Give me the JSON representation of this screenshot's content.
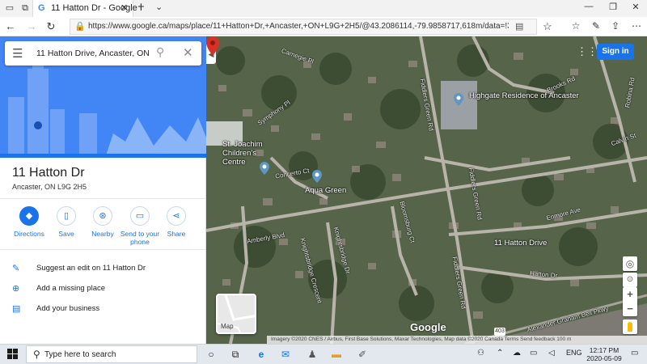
{
  "browser": {
    "tab_title": "11 Hatton Dr - Google I",
    "url": "https://www.google.ca/maps/place/11+Hatton+Dr,+Ancaster,+ON+L9G+2H5/@43.2086114,-79.9858717,618m/data=!3m1!1e3!4m5!3m4!1s0x882c85"
  },
  "search": {
    "query": "11 Hatton Drive, Ancaster, ON"
  },
  "place": {
    "name": "11 Hatton Dr",
    "address": "Ancaster, ON L9G 2H5"
  },
  "actions": [
    {
      "label": "Directions",
      "icon": "directions-icon"
    },
    {
      "label": "Save",
      "icon": "bookmark-icon"
    },
    {
      "label": "Nearby",
      "icon": "nearby-icon"
    },
    {
      "label": "Send to your phone",
      "icon": "phone-icon"
    },
    {
      "label": "Share",
      "icon": "share-icon"
    }
  ],
  "menu": [
    {
      "label": "Suggest an edit on 11 Hatton Dr",
      "icon": "pencil-icon"
    },
    {
      "label": "Add a missing place",
      "icon": "add-place-icon"
    },
    {
      "label": "Add your business",
      "icon": "business-icon"
    }
  ],
  "map": {
    "sign_in": "Sign in",
    "minimap_label": "Map",
    "logo": "Google",
    "pin_label": "11 Hatton Drive",
    "highway_shield": "403",
    "attribution": "Imagery ©2020 CNES / Airbus, First Base Solutions, Maxar Technologies, Map data ©2020    Canada    Terms    Send feedback    100 m",
    "places": [
      {
        "name": "Highgate Residence of Ancaster"
      },
      {
        "name": "St. Joachim Children's Centre"
      },
      {
        "name": "Aqua Green"
      }
    ],
    "roads": [
      "Carnegie Pl",
      "Symphony Pl",
      "Concerto Ct",
      "Fiddlers Green Rd",
      "Brooks Rd",
      "Robina Rd",
      "Calvin St",
      "Enmore Ave",
      "Amberly Blvd",
      "Bloomsburg Ct",
      "Knightsbridge Dr",
      "Knightsbridge Crescent",
      "Hatton Dr",
      "Alexander Graham Bell Pkwy",
      "Concerto Ct",
      "Knightsbridge Ct",
      "Carrington Crescent",
      "Macgregor Dr",
      "Calvin St",
      "Hatton Dr"
    ]
  },
  "taskbar": {
    "search_placeholder": "Type here to search",
    "lang": "ENG",
    "time": "12:17 PM",
    "date": "2020-05-09"
  },
  "colors": {
    "accent": "#1a73e8",
    "hero_bg": "#4285f4",
    "pin": "#d93025"
  }
}
